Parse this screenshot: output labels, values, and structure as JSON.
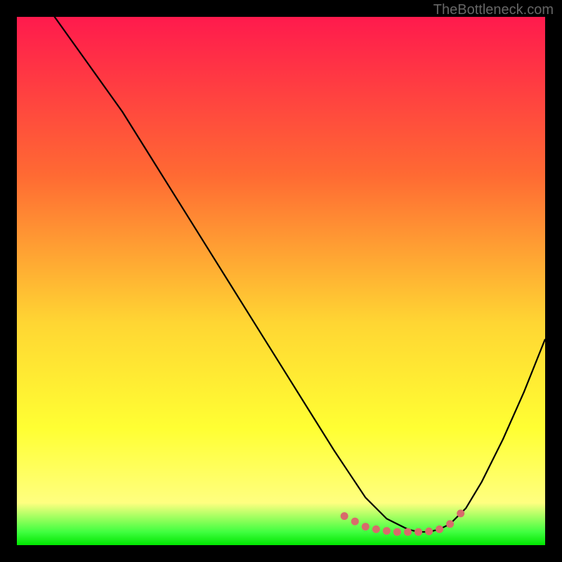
{
  "watermark": "TheBottleneck.com",
  "chart_data": {
    "type": "line",
    "title": "",
    "xlabel": "",
    "ylabel": "",
    "xlim": [
      0,
      100
    ],
    "ylim": [
      0,
      100
    ],
    "background_gradient": {
      "stops": [
        {
          "offset": 0.0,
          "color": "#ff1a4d"
        },
        {
          "offset": 0.3,
          "color": "#ff6a33"
        },
        {
          "offset": 0.58,
          "color": "#ffd633"
        },
        {
          "offset": 0.78,
          "color": "#ffff33"
        },
        {
          "offset": 0.92,
          "color": "#ffff80"
        },
        {
          "offset": 0.975,
          "color": "#40ff40"
        },
        {
          "offset": 1.0,
          "color": "#00e600"
        }
      ]
    },
    "series": [
      {
        "name": "bottleneck-curve",
        "color": "#000000",
        "x": [
          0,
          5,
          10,
          15,
          20,
          25,
          30,
          35,
          40,
          45,
          50,
          55,
          60,
          62,
          64,
          66,
          68,
          70,
          72,
          74,
          76,
          78,
          80,
          82,
          85,
          88,
          92,
          96,
          100
        ],
        "values": [
          110,
          103,
          96,
          89,
          82,
          74,
          66,
          58,
          50,
          42,
          34,
          26,
          18,
          15,
          12,
          9,
          7,
          5,
          4,
          3,
          2.5,
          2.5,
          3,
          4,
          7,
          12,
          20,
          29,
          39
        ]
      }
    ],
    "highlight_dots": {
      "color": "#d86b6b",
      "points": [
        {
          "x": 62,
          "y": 5.5
        },
        {
          "x": 64,
          "y": 4.5
        },
        {
          "x": 66,
          "y": 3.5
        },
        {
          "x": 68,
          "y": 3.0
        },
        {
          "x": 70,
          "y": 2.7
        },
        {
          "x": 72,
          "y": 2.5
        },
        {
          "x": 74,
          "y": 2.5
        },
        {
          "x": 76,
          "y": 2.5
        },
        {
          "x": 78,
          "y": 2.6
        },
        {
          "x": 80,
          "y": 3.0
        },
        {
          "x": 82,
          "y": 4.0
        },
        {
          "x": 84,
          "y": 6.0
        }
      ]
    }
  }
}
